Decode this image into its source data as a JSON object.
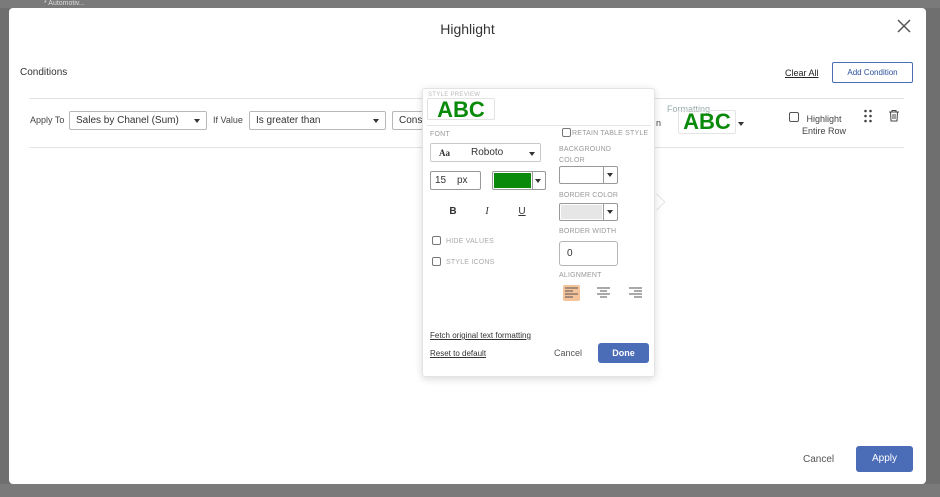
{
  "background": {
    "tab_label": "* Automotiv..."
  },
  "dialog": {
    "title": "Highlight",
    "conditions_label": "Conditions",
    "clear_all": "Clear All",
    "add_condition": "Add Condition",
    "footer": {
      "cancel": "Cancel",
      "apply": "Apply"
    }
  },
  "condition_row": {
    "apply_to_label": "Apply To",
    "apply_to_value": "Sales by Chanel (Sum)",
    "if_value_label": "If Value",
    "operator_value": "Is greater than",
    "type_value_partial": "Cons",
    "then_partial": "n",
    "formatting_label": "Formatting",
    "formatting_preview": "ABC",
    "highlight_entire_row": "Highlight Entire Row",
    "highlight_entire_row_checked": false
  },
  "style_popover": {
    "style_preview_label": "STYLE PREVIEW",
    "preview_text": "ABC",
    "preview_color": "#0a8a0a",
    "font_label": "FONT",
    "font_icon_text": "Aa",
    "font_family": "Roboto",
    "font_size": "15",
    "font_unit": "px",
    "text_color": "#0a8a0a",
    "bold": "B",
    "italic": "I",
    "underline": "U",
    "hide_values": "HIDE VALUES",
    "style_icons": "STYLE ICONS",
    "retain_table_style": "RETAIN TABLE STYLE",
    "background_color_label": "BACKGROUND COLOR",
    "border_color_label": "BORDER COLOR",
    "border_width_label": "BORDER WIDTH",
    "border_width_value": "0",
    "alignment_label": "ALIGNMENT",
    "alignment_selected": "left",
    "fetch_original": "Fetch original text formatting",
    "reset_default": "Reset to default",
    "cancel": "Cancel",
    "done": "Done"
  },
  "colors": {
    "primary_button": "#4b6cb7",
    "preview_green": "#0a8a0a",
    "alignment_active": "#f4c39a"
  }
}
